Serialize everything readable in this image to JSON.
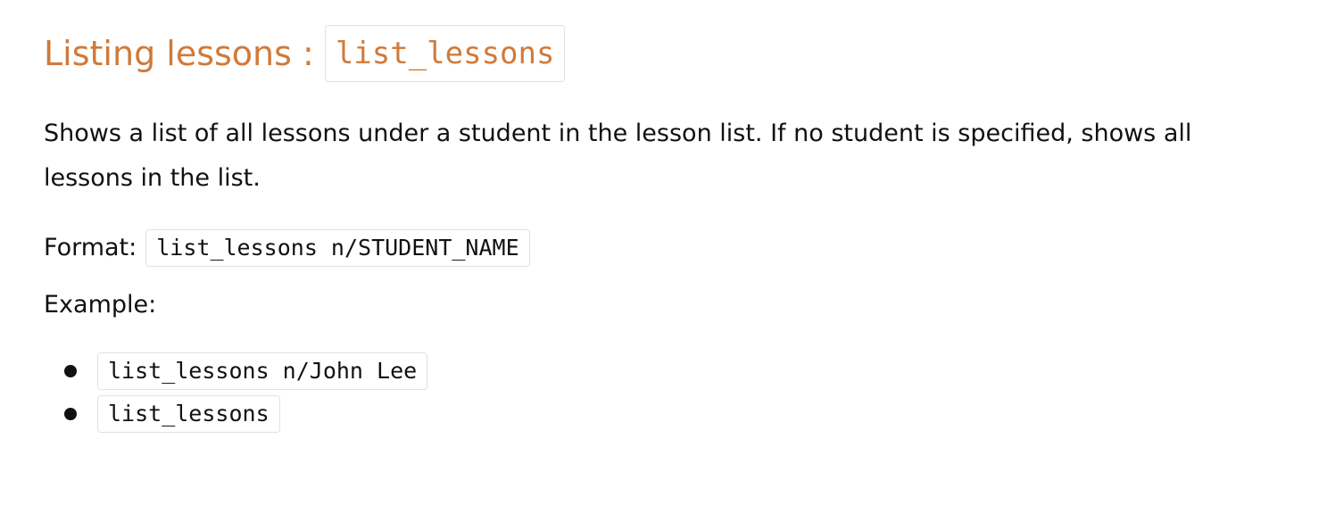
{
  "section": {
    "heading_text": "Listing lessons :",
    "command_name": "list_lessons",
    "description": "Shows a list of all lessons under a student in the lesson list. If no student is specified, shows all lessons in the list.",
    "format_label": "Format:",
    "format_code": "list_lessons n/STUDENT_NAME",
    "example_label": "Example:",
    "examples": [
      "list_lessons n/John Lee",
      "list_lessons"
    ]
  },
  "colors": {
    "heading": "#d07a3a",
    "text": "#111111",
    "code_border": "#e1e1e1"
  }
}
